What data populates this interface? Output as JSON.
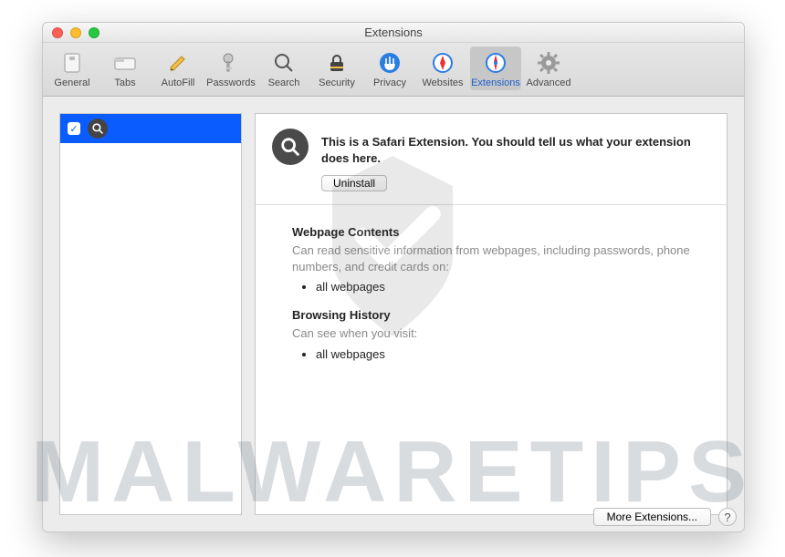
{
  "window": {
    "title": "Extensions"
  },
  "toolbar": {
    "items": [
      {
        "label": "General",
        "icon": "switch-icon"
      },
      {
        "label": "Tabs",
        "icon": "tab-icon"
      },
      {
        "label": "AutoFill",
        "icon": "pencil-icon"
      },
      {
        "label": "Passwords",
        "icon": "key-icon"
      },
      {
        "label": "Search",
        "icon": "magnifier-icon"
      },
      {
        "label": "Security",
        "icon": "lock-icon"
      },
      {
        "label": "Privacy",
        "icon": "hand-icon"
      },
      {
        "label": "Websites",
        "icon": "compass-icon"
      },
      {
        "label": "Extensions",
        "icon": "puzzle-icon",
        "selected": true
      },
      {
        "label": "Advanced",
        "icon": "gear-icon"
      }
    ]
  },
  "sidebar": {
    "items": [
      {
        "checked": true,
        "icon": "magnifier-icon"
      }
    ]
  },
  "detail": {
    "description": "This is a Safari Extension. You should tell us what your extension does here.",
    "uninstall_label": "Uninstall",
    "sections": [
      {
        "title": "Webpage Contents",
        "subtitle": "Can read sensitive information from webpages, including passwords, phone numbers, and credit cards on:",
        "items": [
          "all webpages"
        ]
      },
      {
        "title": "Browsing History",
        "subtitle": "Can see when you visit:",
        "items": [
          "all webpages"
        ]
      }
    ]
  },
  "footer": {
    "more_label": "More Extensions...",
    "help_label": "?"
  },
  "watermark": {
    "text": "MALWARETIPS"
  }
}
